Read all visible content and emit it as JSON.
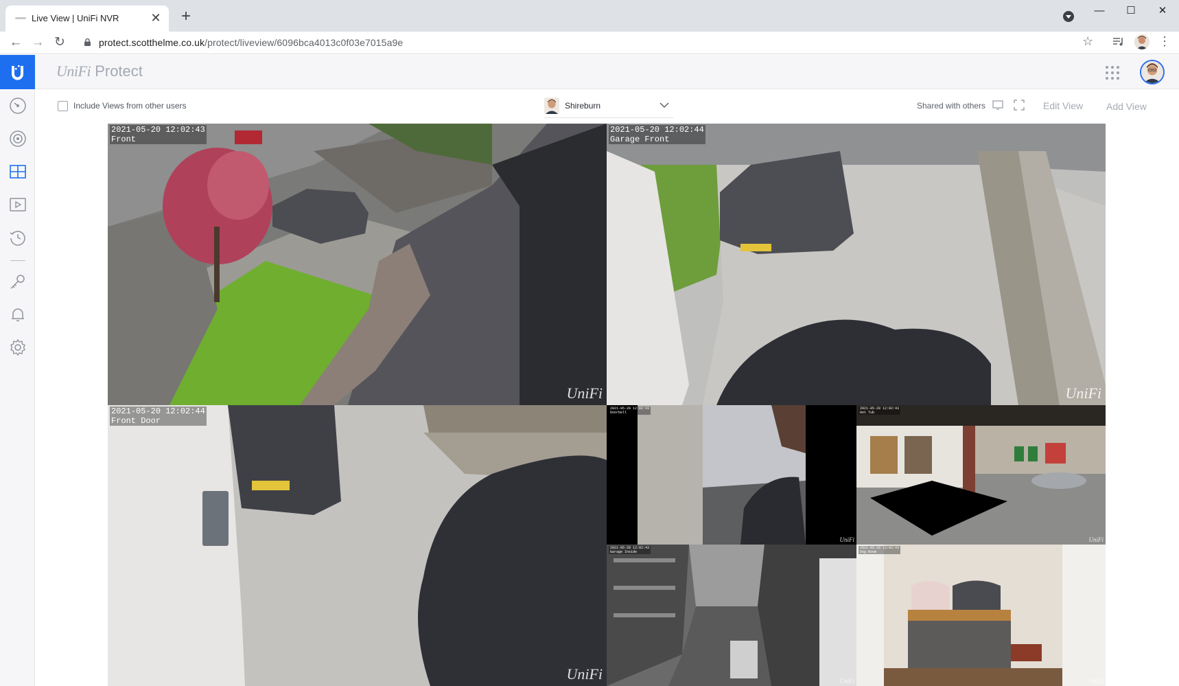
{
  "browser": {
    "tab_title": "Live View | UniFi NVR",
    "tab_close": "✕",
    "new_tab": "+",
    "url_host": "protect.scotthelme.co.uk",
    "url_path": "/protect/liveview/6096bca4013c0f03e7015a9e",
    "window_minimize": "—",
    "window_maximize": "☐",
    "window_close": "✕"
  },
  "app": {
    "brand_unifi": "UniFi",
    "brand_product": "Protect"
  },
  "toolbar": {
    "include_views_label": "Include Views from other users",
    "view_name": "Shireburn",
    "shared_label": "Shared with others",
    "edit_view": "Edit View",
    "add_view": "Add View"
  },
  "cameras": [
    {
      "timestamp": "2021-05-20 12:02:43",
      "name": "Front",
      "watermark": "UniFi"
    },
    {
      "timestamp": "2021-05-20 12:02:44",
      "name": "Garage Front",
      "watermark": "UniFi"
    },
    {
      "timestamp": "2021-05-20 12:02:44",
      "name": "Front Door",
      "watermark": "UniFi"
    },
    {
      "timestamp": "2021-05-20 12:02:43",
      "name": "Doorbell",
      "watermark": "UniFi"
    },
    {
      "timestamp": "2021-05-20 12:02:43",
      "name": "Hot Tub",
      "watermark": "UniFi"
    },
    {
      "timestamp": "2021-05-20 12:02:43",
      "name": "Garage Inside",
      "watermark": "UniFi"
    },
    {
      "timestamp": "2021-05-20 12:02:43",
      "name": "Dog Room",
      "watermark": "UniFi"
    }
  ],
  "icons": {
    "sidebar": [
      "dashboard-icon",
      "cameras-icon",
      "liveview-icon",
      "recordings-icon",
      "timelapse-icon",
      "integrations-icon",
      "notifications-icon",
      "settings-icon"
    ]
  },
  "colors": {
    "accent": "#1e6ff0",
    "sidebar_bg": "#f6f6f8"
  }
}
